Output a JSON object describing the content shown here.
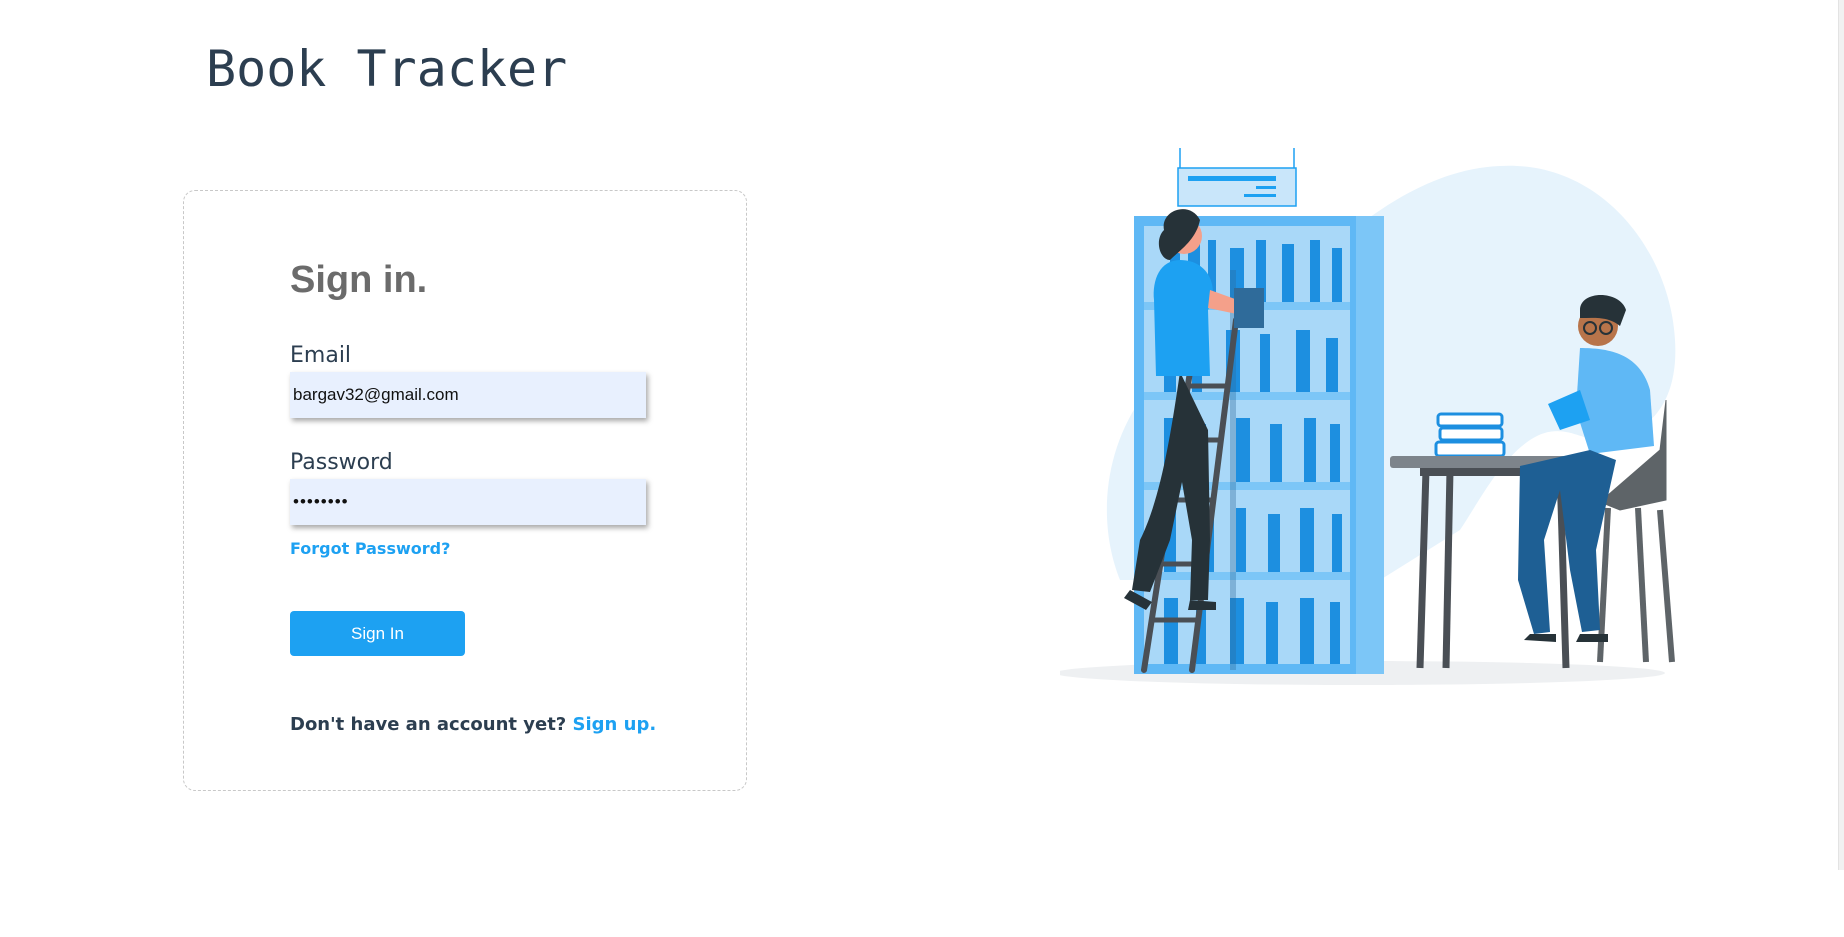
{
  "app": {
    "title": "Book Tracker"
  },
  "form": {
    "heading": "Sign in.",
    "email_label": "Email",
    "email_value": "bargav32@gmail.com",
    "password_label": "Password",
    "password_value": "12345678",
    "forgot_password": "Forgot Password?",
    "signin_button": "Sign In",
    "signup_prompt": "Don't have an account yet?",
    "signup_link": "Sign up."
  },
  "colors": {
    "accent": "#1da1f2",
    "title_text": "#2c3e50",
    "input_bg": "#e8f0fe",
    "heading_gray": "#6b6b6b"
  },
  "illustration": {
    "icon": "library-illustration"
  }
}
